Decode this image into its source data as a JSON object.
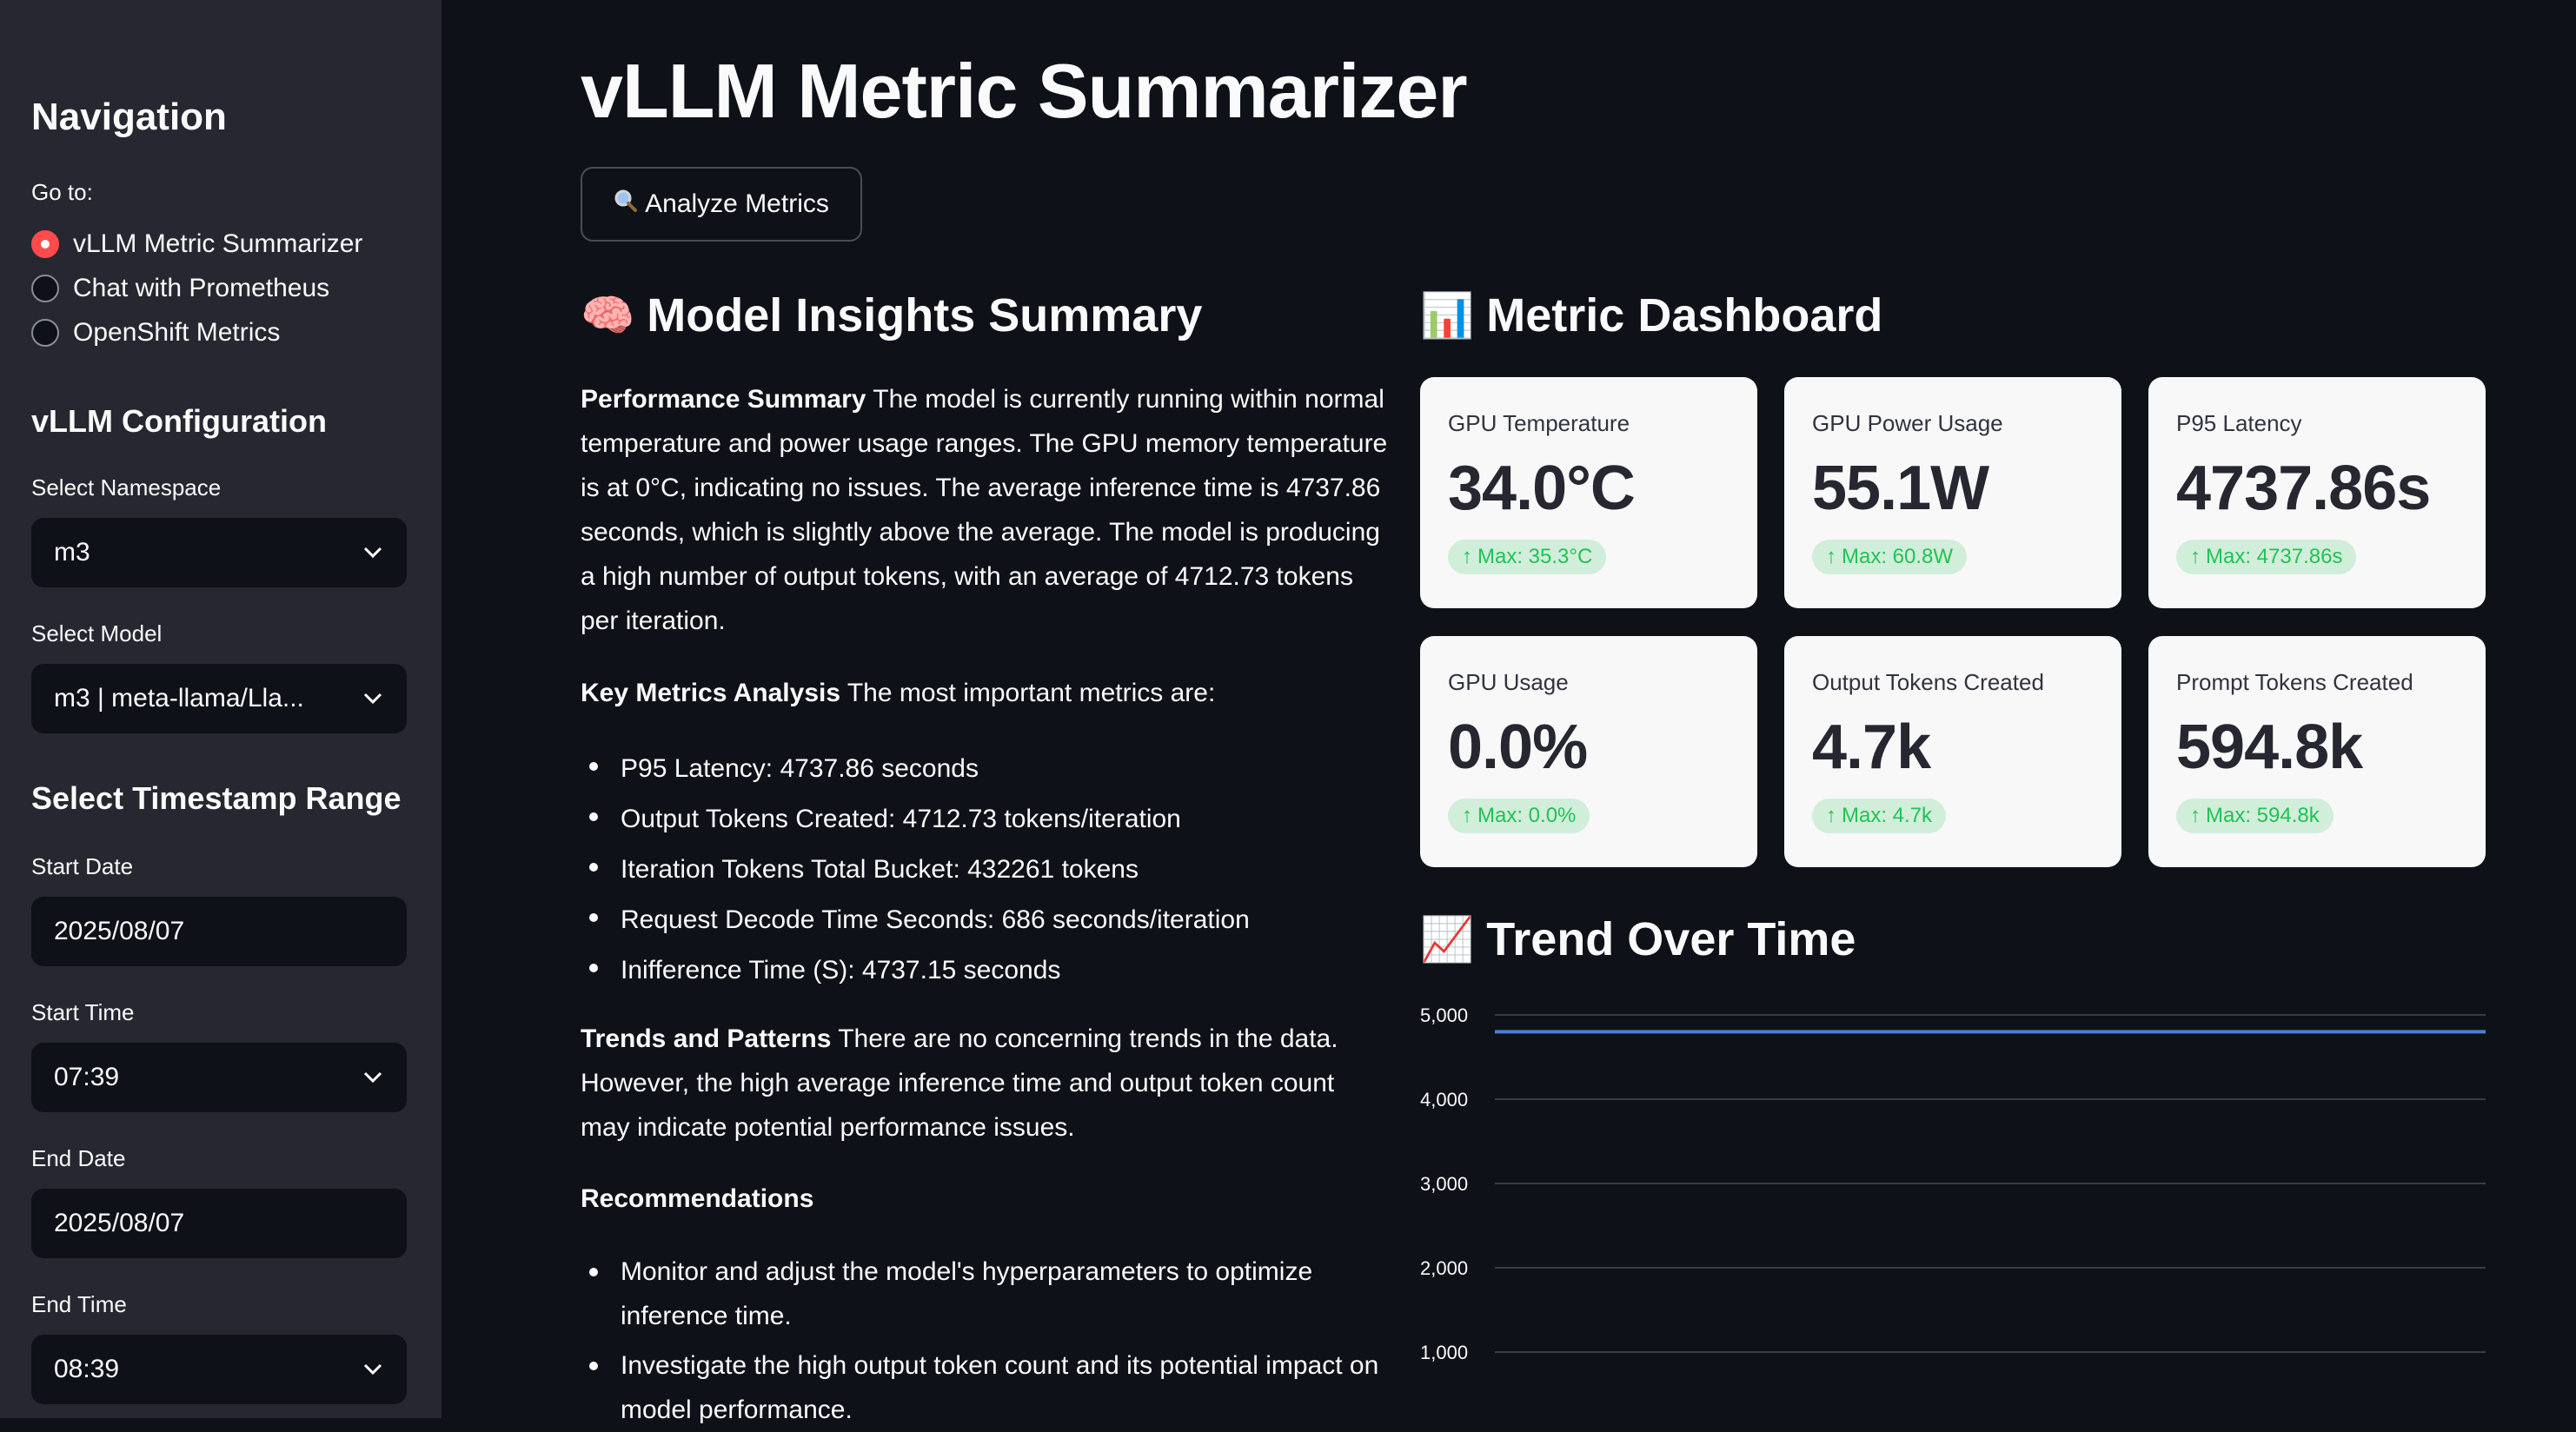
{
  "sidebar": {
    "heading": "Navigation",
    "go_to_label": "Go to:",
    "nav_options": [
      {
        "label": "vLLM Metric Summarizer",
        "selected": true
      },
      {
        "label": "Chat with Prometheus",
        "selected": false
      },
      {
        "label": "OpenShift Metrics",
        "selected": false
      }
    ],
    "config_heading": "vLLM Configuration",
    "namespace_label": "Select Namespace",
    "namespace_value": "m3",
    "model_label": "Select Model",
    "model_value": "m3 | meta-llama/Lla...",
    "timestamp_heading": "Select Timestamp Range",
    "start_date_label": "Start Date",
    "start_date_value": "2025/08/07",
    "start_time_label": "Start Time",
    "start_time_value": "07:39",
    "end_date_label": "End Date",
    "end_date_value": "2025/08/07",
    "end_time_label": "End Time",
    "end_time_value": "08:39"
  },
  "main": {
    "title": "vLLM Metric Summarizer",
    "analyze_button": "Analyze Metrics",
    "insights": {
      "emoji": "🧠",
      "title": "Model Insights Summary",
      "performance_title": "Performance Summary",
      "performance_text": "The model is currently running within normal temperature and power usage ranges. The GPU memory temperature is at 0°C, indicating no issues. The average inference time is 4737.86 seconds, which is slightly above the average. The model is producing a high number of output tokens, with an average of 4712.73 tokens per iteration.",
      "key_title": "Key Metrics Analysis",
      "key_text": "The most important metrics are:",
      "key_bullets": [
        "P95 Latency: 4737.86 seconds",
        "Output Tokens Created: 4712.73 tokens/iteration",
        "Iteration Tokens Total Bucket: 432261 tokens",
        "Request Decode Time Seconds: 686 seconds/iteration",
        "Inifference Time (S): 4737.15 seconds"
      ],
      "trends_title": "Trends and Patterns",
      "trends_text": "There are no concerning trends in the data. However, the high average inference time and output token count may indicate potential performance issues.",
      "recommendations_title": "Recommendations",
      "recommendations": [
        "Monitor and adjust the model's hyperparameters to optimize inference time.",
        "Investigate the high output token count and its potential impact on model performance."
      ]
    },
    "dashboard": {
      "emoji": "📊",
      "title": "Metric Dashboard",
      "cards": [
        {
          "label": "GPU Temperature",
          "value": "34.0°C",
          "delta": "Max: 35.3°C"
        },
        {
          "label": "GPU Power Usage",
          "value": "55.1W",
          "delta": "Max: 60.8W"
        },
        {
          "label": "P95 Latency",
          "value": "4737.86s",
          "delta": "Max: 4737.86s"
        },
        {
          "label": "GPU Usage",
          "value": "0.0%",
          "delta": "Max: 0.0%"
        },
        {
          "label": "Output Tokens Created",
          "value": "4.7k",
          "delta": "Max: 4.7k"
        },
        {
          "label": "Prompt Tokens Created",
          "value": "594.8k",
          "delta": "Max: 594.8k"
        }
      ],
      "delta_color": "#21c354"
    },
    "trend": {
      "emoji": "📈",
      "title": "Trend Over Time"
    }
  },
  "chart_data": {
    "type": "line",
    "title": "Trend Over Time",
    "xlabel": "",
    "ylabel": "",
    "y_ticks": [
      "1,000",
      "2,000",
      "3,000",
      "4,000",
      "5,000"
    ],
    "ylim": [
      0,
      5000
    ],
    "grid": true,
    "series": [
      {
        "values": [
          4800,
          4800
        ],
        "color": "#4a7fd4"
      }
    ]
  },
  "colors": {
    "accent": "#ff4b4b",
    "sidebar_bg": "#262730",
    "main_bg": "#0e1117",
    "card_bg": "#f8f8f8"
  }
}
